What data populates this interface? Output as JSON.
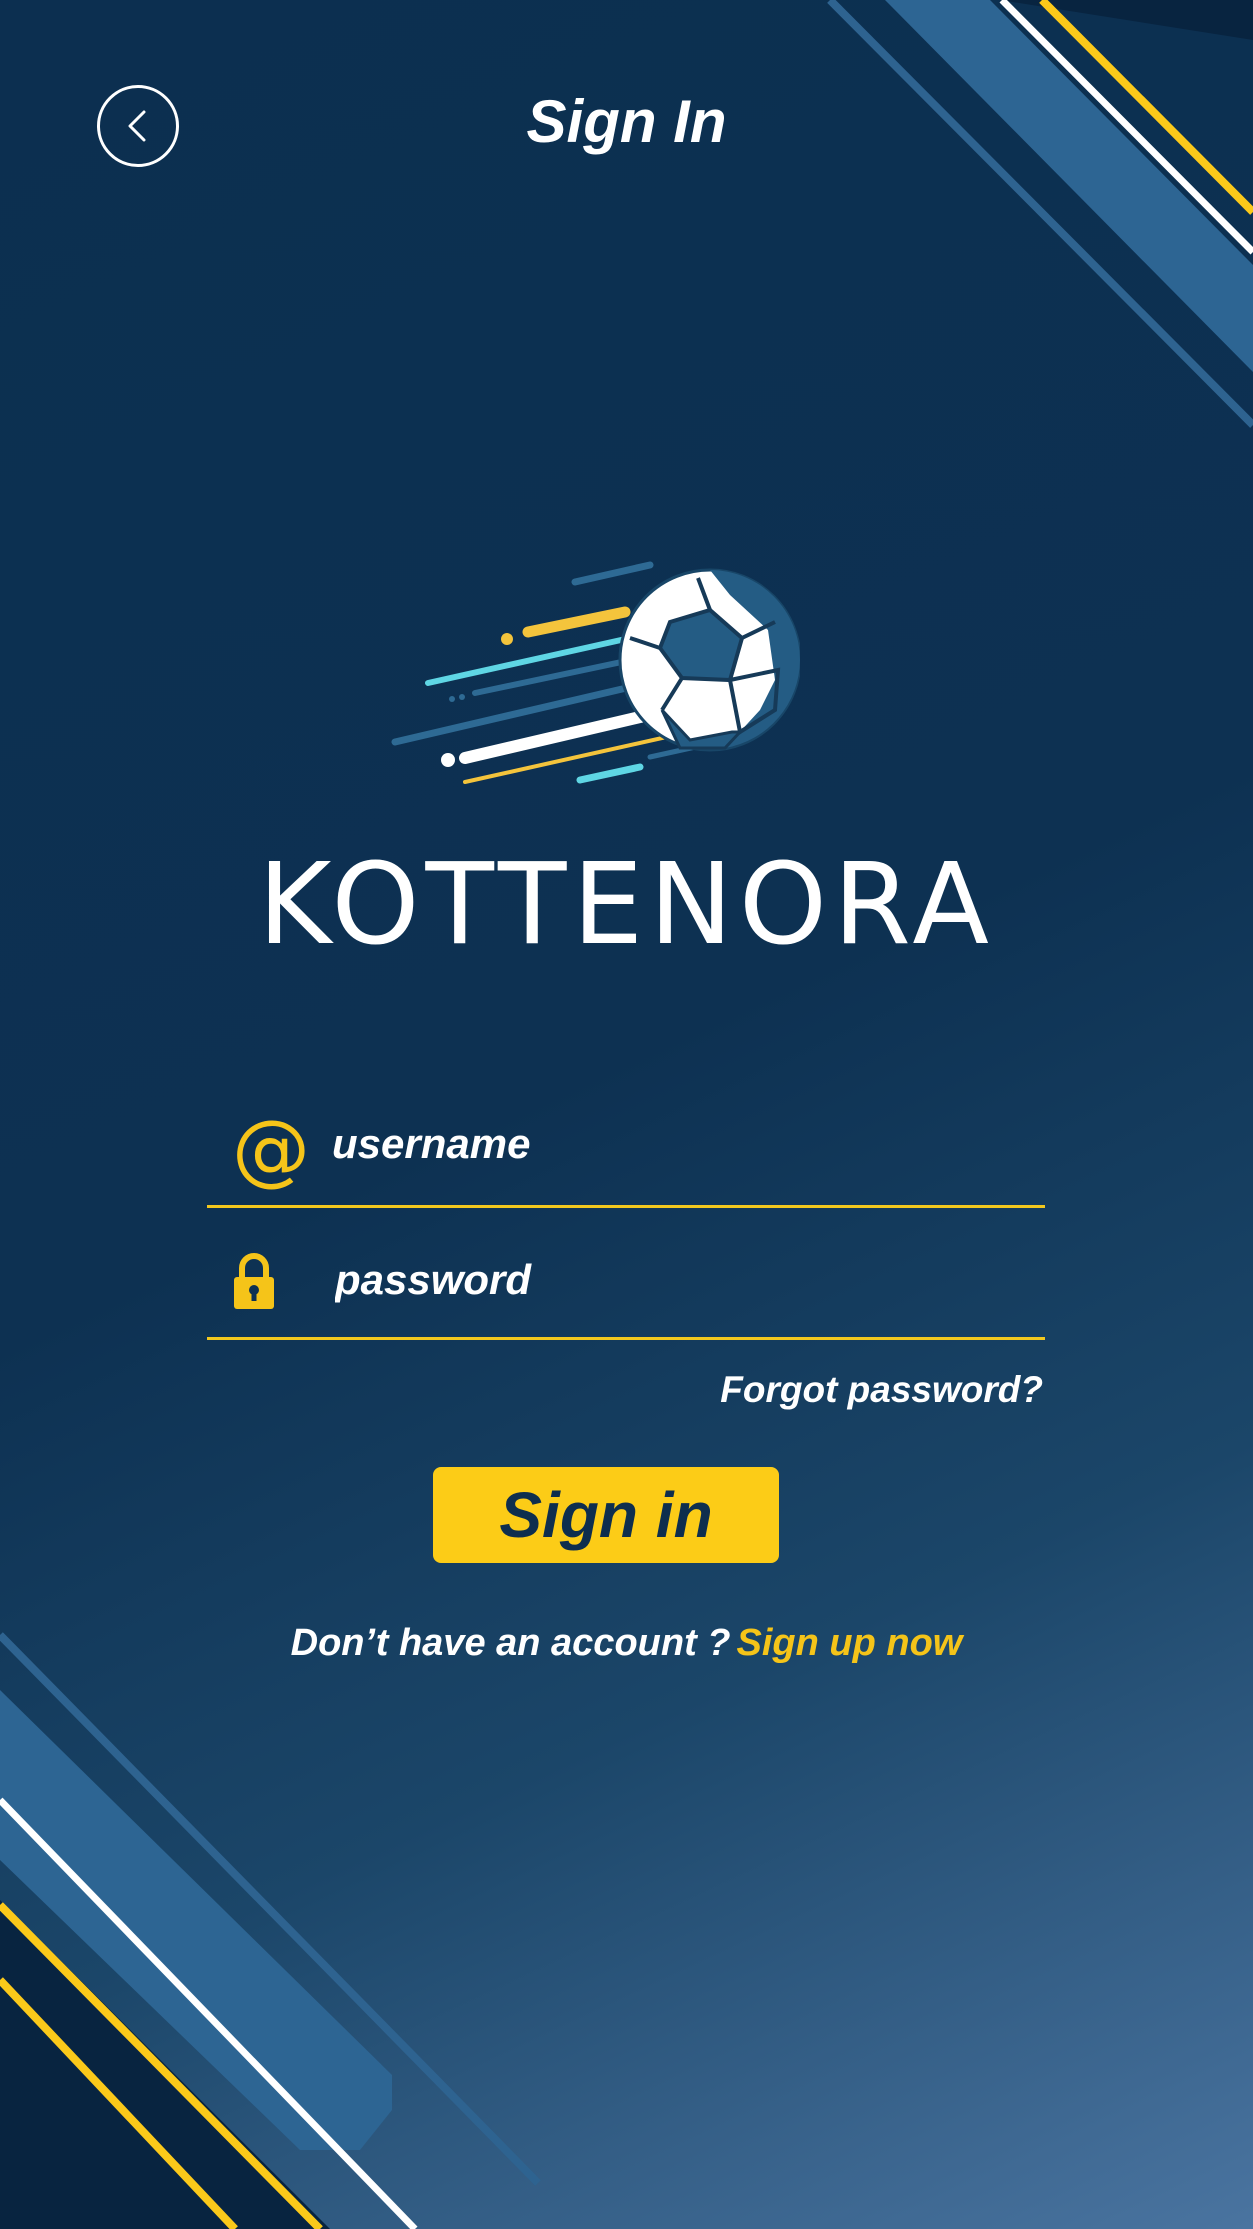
{
  "header": {
    "title": "Sign In",
    "back_icon": "chevron-left-icon"
  },
  "brand": {
    "name": "KOTTENORA",
    "logo_icon": "soccer-ball-icon"
  },
  "form": {
    "username": {
      "icon": "at-sign-icon",
      "icon_glyph": "@",
      "placeholder": "username",
      "value": ""
    },
    "password": {
      "icon": "lock-icon",
      "placeholder": "password",
      "value": ""
    },
    "forgot_label": "Forgot password?",
    "submit_label": "Sign in"
  },
  "footer": {
    "prompt": "Don’t have an account ?",
    "signup_label": "Sign up now"
  },
  "colors": {
    "background": "#0d3152",
    "accent_yellow": "#fccc17",
    "stripe_blue": "#2e6796",
    "text": "#ffffff"
  }
}
